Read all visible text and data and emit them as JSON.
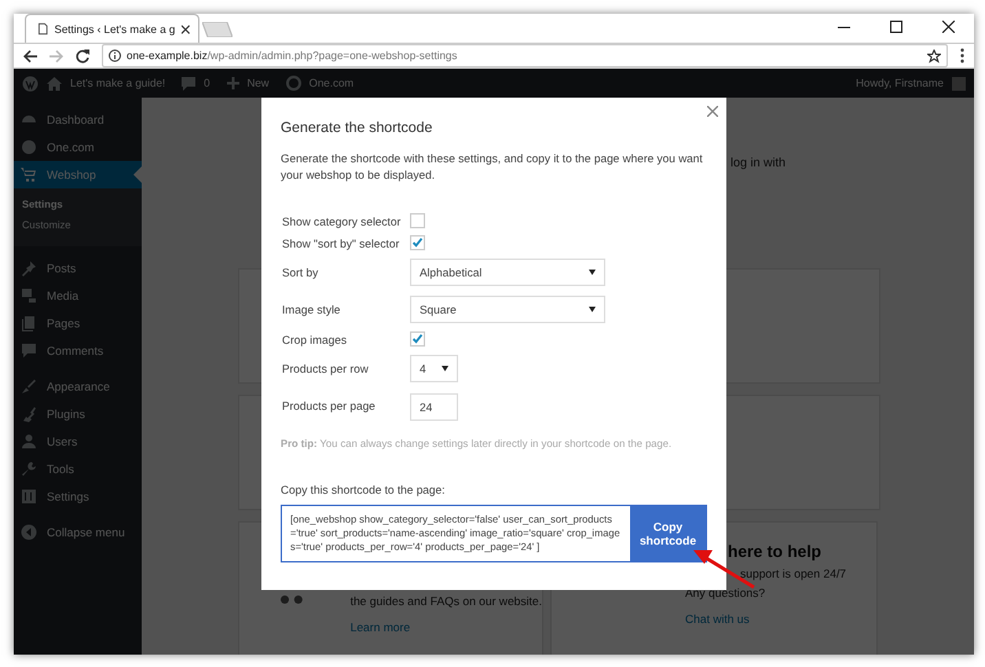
{
  "browser": {
    "tab_title": "Settings ‹ Let's make a g",
    "address": {
      "host": "one-example.biz",
      "path": "/wp-admin/admin.php?page=one-webshop-settings"
    }
  },
  "admin_bar": {
    "site": "Let's make a guide!",
    "comments": "0",
    "new": "New",
    "brand": "One.com",
    "greeting": "Howdy, Firstname"
  },
  "sidebar": {
    "groups": [
      {
        "items": [
          {
            "label": "Dashboard",
            "selected": false
          },
          {
            "label": "One.com",
            "selected": false
          },
          {
            "label": "Webshop",
            "selected": true,
            "children": [
              {
                "label": "Settings",
                "selected": true
              },
              {
                "label": "Customize",
                "selected": false
              }
            ]
          }
        ]
      },
      {
        "items": [
          {
            "label": "Posts",
            "selected": false
          },
          {
            "label": "Media",
            "selected": false
          },
          {
            "label": "Pages",
            "selected": false
          },
          {
            "label": "Comments",
            "selected": false
          }
        ]
      },
      {
        "items": [
          {
            "label": "Appearance",
            "selected": false
          },
          {
            "label": "Plugins",
            "selected": false
          },
          {
            "label": "Users",
            "selected": false
          },
          {
            "label": "Tools",
            "selected": false
          },
          {
            "label": "Settings",
            "selected": false
          }
        ]
      }
    ],
    "collapse": "Collapse menu"
  },
  "background": {
    "intro": "log in with",
    "guides_text": "the guides and FAQs on our website.",
    "guides_link": "Learn more",
    "help_title": "here to help",
    "help_text": "support is open 24/7",
    "help_question": "Any questions?",
    "help_link": "Chat with us"
  },
  "modal": {
    "title": "Generate the shortcode",
    "description": "Generate the shortcode with these settings, and copy it to the page where you want your webshop to be displayed.",
    "fields": [
      {
        "kind": "checkbox",
        "label": "Show category selector",
        "checked": false
      },
      {
        "kind": "checkbox",
        "label": "Show \"sort by\" selector",
        "checked": true
      },
      {
        "kind": "select",
        "label": "Sort by",
        "value": "Alphabetical"
      },
      {
        "kind": "select",
        "label": "Image style",
        "value": "Square"
      },
      {
        "kind": "checkbox",
        "label": "Crop images",
        "checked": true
      },
      {
        "kind": "compact_select",
        "label": "Products per row",
        "value": "4"
      },
      {
        "kind": "input",
        "label": "Products per page",
        "value": "24"
      }
    ],
    "tip": "**Pro tip:** You can always change settings later directly in your shortcode on the page.",
    "copy_label": "Copy this shortcode to the page:",
    "shortcode": "[one_webshop show_category_selector='false' user_can_sort_products='true' sort_products='name-ascending' image_ratio='square' crop_images='true' products_per_row='4' products_per_page='24' ]",
    "copy_button": "Copy shortcode"
  }
}
